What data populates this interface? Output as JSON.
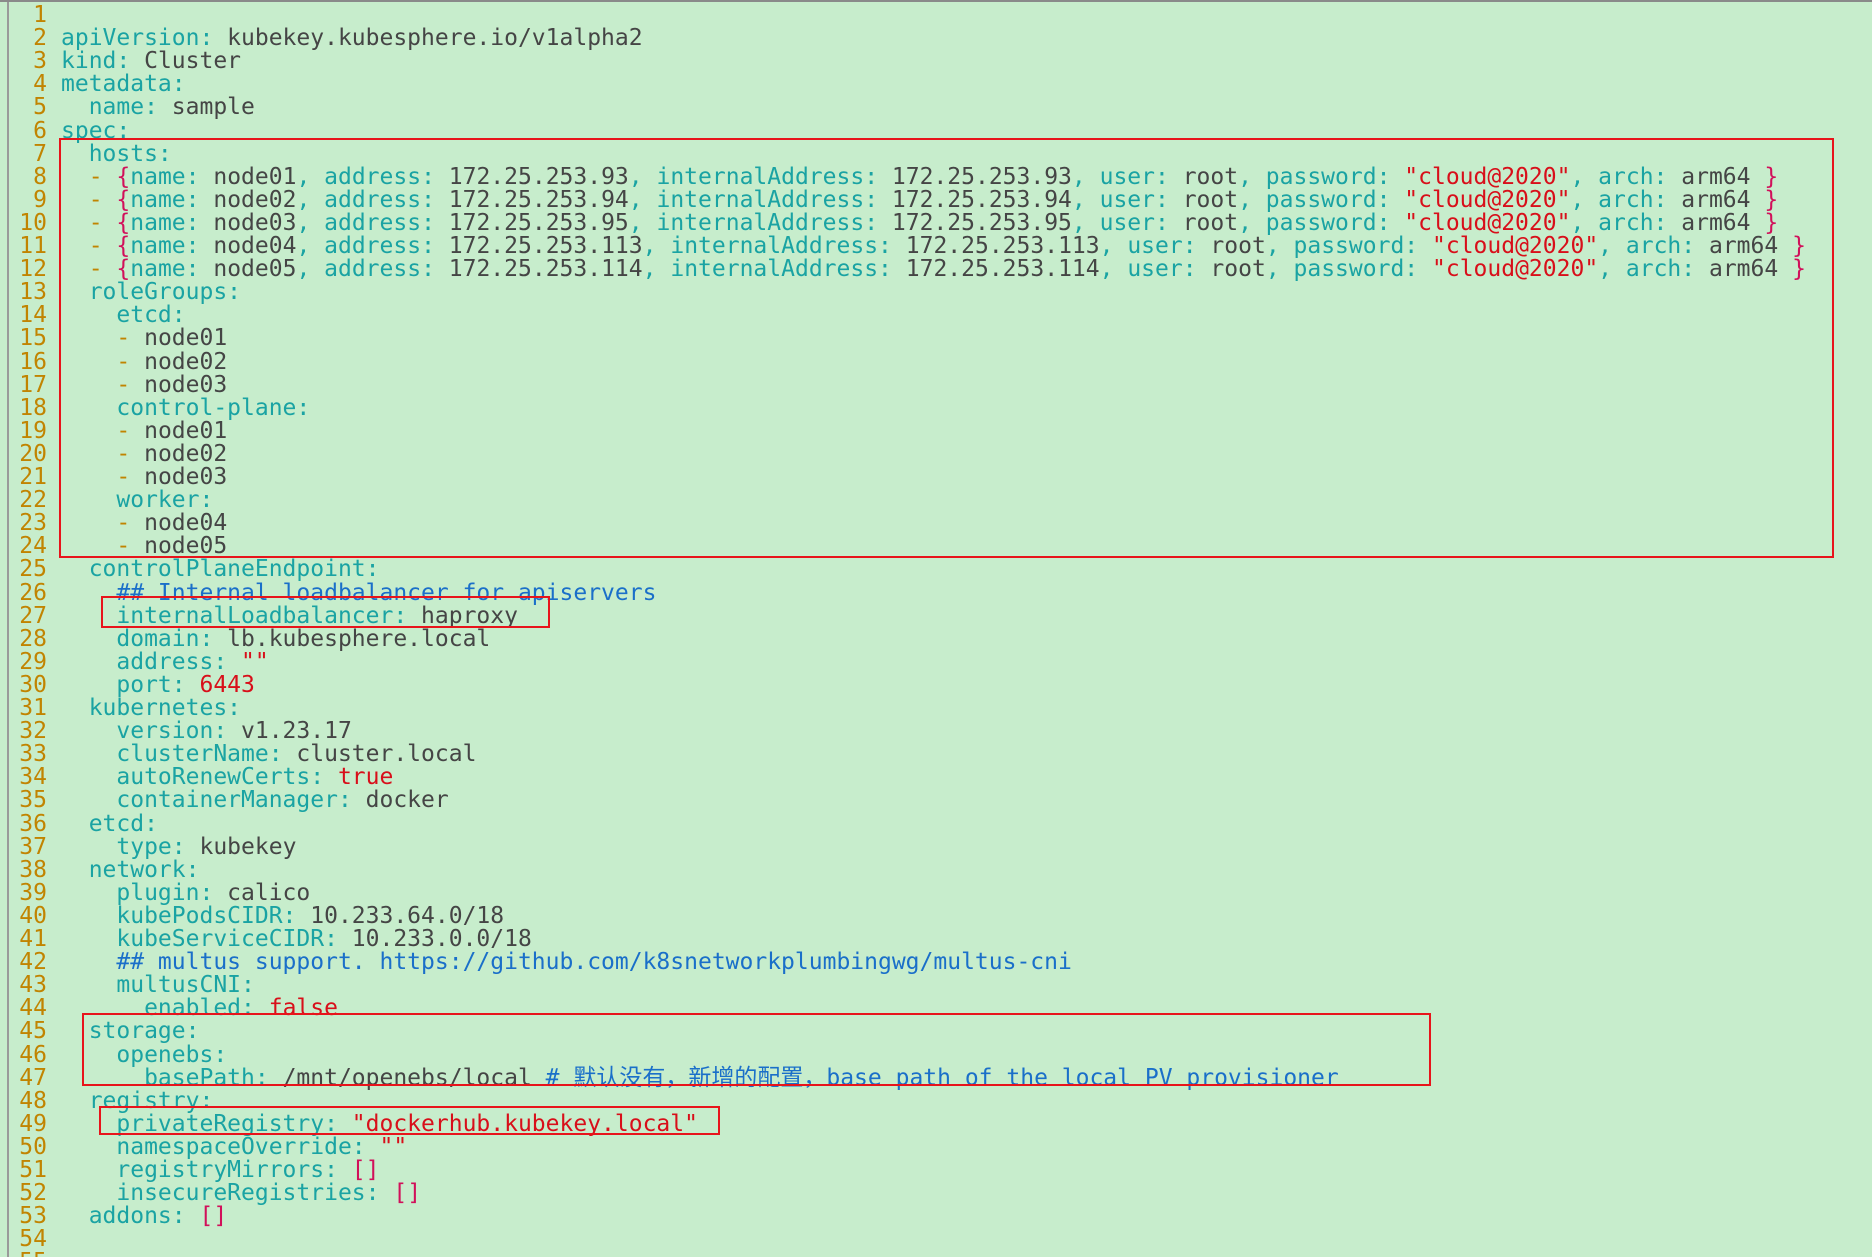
{
  "colors": {
    "background": "#c7edcc",
    "line_number": "#c18401",
    "key": "#1aa3a3",
    "value": "#454545",
    "string": "#d80f1a",
    "brace": "#d1105a",
    "comment": "#1a6fc9",
    "highlight_box": "#e8141b"
  },
  "lines": [
    {
      "n": "1",
      "segs": []
    },
    {
      "n": "2",
      "segs": [
        {
          "t": "apiVersion: ",
          "c": "k"
        },
        {
          "t": "kubekey.kubesphere.io/v1alpha2",
          "c": "v"
        }
      ]
    },
    {
      "n": "3",
      "segs": [
        {
          "t": "kind: ",
          "c": "k"
        },
        {
          "t": "Cluster",
          "c": "v"
        }
      ]
    },
    {
      "n": "4",
      "segs": [
        {
          "t": "metadata:",
          "c": "k"
        }
      ]
    },
    {
      "n": "5",
      "segs": [
        {
          "t": "  name: ",
          "c": "k"
        },
        {
          "t": "sample",
          "c": "v"
        }
      ]
    },
    {
      "n": "6",
      "segs": [
        {
          "t": "spec:",
          "c": "k"
        }
      ]
    },
    {
      "n": "7",
      "segs": [
        {
          "t": "  hosts:",
          "c": "k"
        }
      ]
    },
    {
      "n": "8",
      "segs": [
        {
          "t": "  - ",
          "c": "d"
        },
        {
          "t": "{",
          "c": "b"
        },
        {
          "t": "name: ",
          "c": "k"
        },
        {
          "t": "node01",
          "c": "v"
        },
        {
          "t": ", ",
          "c": "k"
        },
        {
          "t": "address: ",
          "c": "k"
        },
        {
          "t": "172.25.253.93",
          "c": "v"
        },
        {
          "t": ", ",
          "c": "k"
        },
        {
          "t": "internalAddress: ",
          "c": "k"
        },
        {
          "t": "172.25.253.93",
          "c": "v"
        },
        {
          "t": ", ",
          "c": "k"
        },
        {
          "t": "user: ",
          "c": "k"
        },
        {
          "t": "root",
          "c": "v"
        },
        {
          "t": ", ",
          "c": "k"
        },
        {
          "t": "password: ",
          "c": "k"
        },
        {
          "t": "\"cloud@2020\"",
          "c": "s"
        },
        {
          "t": ", ",
          "c": "k"
        },
        {
          "t": "arch: ",
          "c": "k"
        },
        {
          "t": "arm64 ",
          "c": "v"
        },
        {
          "t": "}",
          "c": "b"
        }
      ]
    },
    {
      "n": "9",
      "segs": [
        {
          "t": "  - ",
          "c": "d"
        },
        {
          "t": "{",
          "c": "b"
        },
        {
          "t": "name: ",
          "c": "k"
        },
        {
          "t": "node02",
          "c": "v"
        },
        {
          "t": ", ",
          "c": "k"
        },
        {
          "t": "address: ",
          "c": "k"
        },
        {
          "t": "172.25.253.94",
          "c": "v"
        },
        {
          "t": ", ",
          "c": "k"
        },
        {
          "t": "internalAddress: ",
          "c": "k"
        },
        {
          "t": "172.25.253.94",
          "c": "v"
        },
        {
          "t": ", ",
          "c": "k"
        },
        {
          "t": "user: ",
          "c": "k"
        },
        {
          "t": "root",
          "c": "v"
        },
        {
          "t": ", ",
          "c": "k"
        },
        {
          "t": "password: ",
          "c": "k"
        },
        {
          "t": "\"cloud@2020\"",
          "c": "s"
        },
        {
          "t": ", ",
          "c": "k"
        },
        {
          "t": "arch: ",
          "c": "k"
        },
        {
          "t": "arm64 ",
          "c": "v"
        },
        {
          "t": "}",
          "c": "b"
        }
      ]
    },
    {
      "n": "10",
      "segs": [
        {
          "t": "  - ",
          "c": "d"
        },
        {
          "t": "{",
          "c": "b"
        },
        {
          "t": "name: ",
          "c": "k"
        },
        {
          "t": "node03",
          "c": "v"
        },
        {
          "t": ", ",
          "c": "k"
        },
        {
          "t": "address: ",
          "c": "k"
        },
        {
          "t": "172.25.253.95",
          "c": "v"
        },
        {
          "t": ", ",
          "c": "k"
        },
        {
          "t": "internalAddress: ",
          "c": "k"
        },
        {
          "t": "172.25.253.95",
          "c": "v"
        },
        {
          "t": ", ",
          "c": "k"
        },
        {
          "t": "user: ",
          "c": "k"
        },
        {
          "t": "root",
          "c": "v"
        },
        {
          "t": ", ",
          "c": "k"
        },
        {
          "t": "password: ",
          "c": "k"
        },
        {
          "t": "\"cloud@2020\"",
          "c": "s"
        },
        {
          "t": ", ",
          "c": "k"
        },
        {
          "t": "arch: ",
          "c": "k"
        },
        {
          "t": "arm64 ",
          "c": "v"
        },
        {
          "t": "}",
          "c": "b"
        }
      ]
    },
    {
      "n": "11",
      "segs": [
        {
          "t": "  - ",
          "c": "d"
        },
        {
          "t": "{",
          "c": "b"
        },
        {
          "t": "name: ",
          "c": "k"
        },
        {
          "t": "node04",
          "c": "v"
        },
        {
          "t": ", ",
          "c": "k"
        },
        {
          "t": "address: ",
          "c": "k"
        },
        {
          "t": "172.25.253.113",
          "c": "v"
        },
        {
          "t": ", ",
          "c": "k"
        },
        {
          "t": "internalAddress: ",
          "c": "k"
        },
        {
          "t": "172.25.253.113",
          "c": "v"
        },
        {
          "t": ", ",
          "c": "k"
        },
        {
          "t": "user: ",
          "c": "k"
        },
        {
          "t": "root",
          "c": "v"
        },
        {
          "t": ", ",
          "c": "k"
        },
        {
          "t": "password: ",
          "c": "k"
        },
        {
          "t": "\"cloud@2020\"",
          "c": "s"
        },
        {
          "t": ", ",
          "c": "k"
        },
        {
          "t": "arch: ",
          "c": "k"
        },
        {
          "t": "arm64 ",
          "c": "v"
        },
        {
          "t": "}",
          "c": "b"
        }
      ]
    },
    {
      "n": "12",
      "segs": [
        {
          "t": "  - ",
          "c": "d"
        },
        {
          "t": "{",
          "c": "b"
        },
        {
          "t": "name: ",
          "c": "k"
        },
        {
          "t": "node05",
          "c": "v"
        },
        {
          "t": ", ",
          "c": "k"
        },
        {
          "t": "address: ",
          "c": "k"
        },
        {
          "t": "172.25.253.114",
          "c": "v"
        },
        {
          "t": ", ",
          "c": "k"
        },
        {
          "t": "internalAddress: ",
          "c": "k"
        },
        {
          "t": "172.25.253.114",
          "c": "v"
        },
        {
          "t": ", ",
          "c": "k"
        },
        {
          "t": "user: ",
          "c": "k"
        },
        {
          "t": "root",
          "c": "v"
        },
        {
          "t": ", ",
          "c": "k"
        },
        {
          "t": "password: ",
          "c": "k"
        },
        {
          "t": "\"cloud@2020\"",
          "c": "s"
        },
        {
          "t": ", ",
          "c": "k"
        },
        {
          "t": "arch: ",
          "c": "k"
        },
        {
          "t": "arm64 ",
          "c": "v"
        },
        {
          "t": "}",
          "c": "b"
        }
      ]
    },
    {
      "n": "13",
      "segs": [
        {
          "t": "  roleGroups:",
          "c": "k"
        }
      ]
    },
    {
      "n": "14",
      "segs": [
        {
          "t": "    etcd:",
          "c": "k"
        }
      ]
    },
    {
      "n": "15",
      "segs": [
        {
          "t": "    - ",
          "c": "d"
        },
        {
          "t": "node01",
          "c": "v"
        }
      ]
    },
    {
      "n": "16",
      "segs": [
        {
          "t": "    - ",
          "c": "d"
        },
        {
          "t": "node02",
          "c": "v"
        }
      ]
    },
    {
      "n": "17",
      "segs": [
        {
          "t": "    - ",
          "c": "d"
        },
        {
          "t": "node03",
          "c": "v"
        }
      ]
    },
    {
      "n": "18",
      "segs": [
        {
          "t": "    control-plane:",
          "c": "k"
        }
      ]
    },
    {
      "n": "19",
      "segs": [
        {
          "t": "    - ",
          "c": "d"
        },
        {
          "t": "node01",
          "c": "v"
        }
      ]
    },
    {
      "n": "20",
      "segs": [
        {
          "t": "    - ",
          "c": "d"
        },
        {
          "t": "node02",
          "c": "v"
        }
      ]
    },
    {
      "n": "21",
      "segs": [
        {
          "t": "    - ",
          "c": "d"
        },
        {
          "t": "node03",
          "c": "v"
        }
      ]
    },
    {
      "n": "22",
      "segs": [
        {
          "t": "    worker:",
          "c": "k"
        }
      ]
    },
    {
      "n": "23",
      "segs": [
        {
          "t": "    - ",
          "c": "d"
        },
        {
          "t": "node04",
          "c": "v"
        }
      ]
    },
    {
      "n": "24",
      "segs": [
        {
          "t": "    - ",
          "c": "d"
        },
        {
          "t": "node05",
          "c": "v"
        }
      ]
    },
    {
      "n": "25",
      "segs": [
        {
          "t": "  controlPlaneEndpoint:",
          "c": "k"
        }
      ]
    },
    {
      "n": "26",
      "segs": [
        {
          "t": "    ## Internal loadbalancer for apiservers",
          "c": "c"
        }
      ]
    },
    {
      "n": "27",
      "segs": [
        {
          "t": "    internalLoadbalancer: ",
          "c": "k"
        },
        {
          "t": "haproxy",
          "c": "v"
        }
      ]
    },
    {
      "n": "28",
      "segs": [
        {
          "t": "    domain: ",
          "c": "k"
        },
        {
          "t": "lb.kubesphere.local",
          "c": "v"
        }
      ]
    },
    {
      "n": "29",
      "segs": [
        {
          "t": "    address: ",
          "c": "k"
        },
        {
          "t": "\"\"",
          "c": "s"
        }
      ]
    },
    {
      "n": "30",
      "segs": [
        {
          "t": "    port: ",
          "c": "k"
        },
        {
          "t": "6443",
          "c": "s"
        }
      ]
    },
    {
      "n": "31",
      "segs": [
        {
          "t": "  kubernetes:",
          "c": "k"
        }
      ]
    },
    {
      "n": "32",
      "segs": [
        {
          "t": "    version: ",
          "c": "k"
        },
        {
          "t": "v1.23.17",
          "c": "v"
        }
      ]
    },
    {
      "n": "33",
      "segs": [
        {
          "t": "    clusterName: ",
          "c": "k"
        },
        {
          "t": "cluster.local",
          "c": "v"
        }
      ]
    },
    {
      "n": "34",
      "segs": [
        {
          "t": "    autoRenewCerts: ",
          "c": "k"
        },
        {
          "t": "true",
          "c": "s"
        }
      ]
    },
    {
      "n": "35",
      "segs": [
        {
          "t": "    containerManager: ",
          "c": "k"
        },
        {
          "t": "docker",
          "c": "v"
        }
      ]
    },
    {
      "n": "36",
      "segs": [
        {
          "t": "  etcd:",
          "c": "k"
        }
      ]
    },
    {
      "n": "37",
      "segs": [
        {
          "t": "    type: ",
          "c": "k"
        },
        {
          "t": "kubekey",
          "c": "v"
        }
      ]
    },
    {
      "n": "38",
      "segs": [
        {
          "t": "  network:",
          "c": "k"
        }
      ]
    },
    {
      "n": "39",
      "segs": [
        {
          "t": "    plugin: ",
          "c": "k"
        },
        {
          "t": "calico",
          "c": "v"
        }
      ]
    },
    {
      "n": "40",
      "segs": [
        {
          "t": "    kubePodsCIDR: ",
          "c": "k"
        },
        {
          "t": "10.233.64.0/18",
          "c": "v"
        }
      ]
    },
    {
      "n": "41",
      "segs": [
        {
          "t": "    kubeServiceCIDR: ",
          "c": "k"
        },
        {
          "t": "10.233.0.0/18",
          "c": "v"
        }
      ]
    },
    {
      "n": "42",
      "segs": [
        {
          "t": "    ## multus support. https://github.com/k8snetworkplumbingwg/multus-cni",
          "c": "c"
        }
      ]
    },
    {
      "n": "43",
      "segs": [
        {
          "t": "    multusCNI:",
          "c": "k"
        }
      ]
    },
    {
      "n": "44",
      "segs": [
        {
          "t": "      enabled: ",
          "c": "k"
        },
        {
          "t": "false",
          "c": "s"
        }
      ]
    },
    {
      "n": "45",
      "segs": [
        {
          "t": "  storage:",
          "c": "k"
        }
      ]
    },
    {
      "n": "46",
      "segs": [
        {
          "t": "    openebs:",
          "c": "k"
        }
      ]
    },
    {
      "n": "47",
      "segs": [
        {
          "t": "      basePath: ",
          "c": "k"
        },
        {
          "t": "/mnt/openebs/local ",
          "c": "v"
        },
        {
          "t": "# 默认没有，新增的配置，base path of the local PV provisioner",
          "c": "c"
        }
      ]
    },
    {
      "n": "48",
      "segs": [
        {
          "t": "  registry:",
          "c": "k"
        }
      ]
    },
    {
      "n": "49",
      "segs": [
        {
          "t": "    privateRegistry: ",
          "c": "k"
        },
        {
          "t": "\"dockerhub.kubekey.local\"",
          "c": "s"
        }
      ]
    },
    {
      "n": "50",
      "segs": [
        {
          "t": "    namespaceOverride: ",
          "c": "k"
        },
        {
          "t": "\"\"",
          "c": "s"
        }
      ]
    },
    {
      "n": "51",
      "segs": [
        {
          "t": "    registryMirrors: ",
          "c": "k"
        },
        {
          "t": "[]",
          "c": "b"
        }
      ]
    },
    {
      "n": "52",
      "segs": [
        {
          "t": "    insecureRegistries: ",
          "c": "k"
        },
        {
          "t": "[]",
          "c": "b"
        }
      ]
    },
    {
      "n": "53",
      "segs": [
        {
          "t": "  addons: ",
          "c": "k"
        },
        {
          "t": "[]",
          "c": "b"
        }
      ]
    },
    {
      "n": "54",
      "segs": []
    },
    {
      "n": "55",
      "segs": []
    }
  ]
}
